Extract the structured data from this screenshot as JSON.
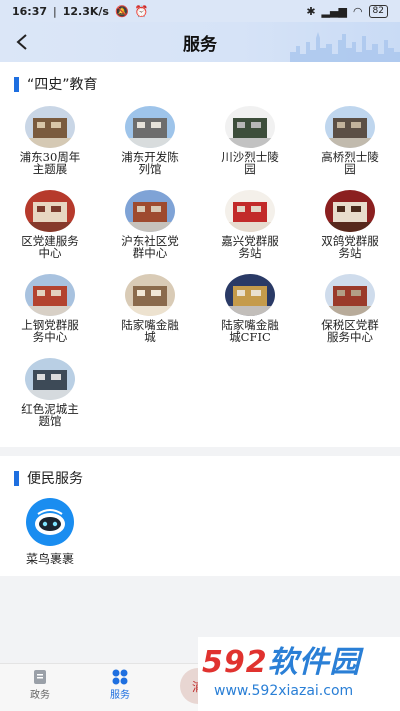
{
  "status": {
    "time": "16:37",
    "speed": "12.3K/s",
    "battery": "82"
  },
  "nav": {
    "title": "服务"
  },
  "education": {
    "title": "“四史”教育",
    "items": [
      {
        "label": "浦东30周年主题展",
        "icon": "exhibition-photo"
      },
      {
        "label": "浦东开发陈列馆",
        "icon": "museum-building-photo"
      },
      {
        "label": "川沙烈士陵园",
        "icon": "memorial-gate-photo"
      },
      {
        "label": "高桥烈士陵园",
        "icon": "memorial-statue-photo"
      },
      {
        "label": "区党建服务中心",
        "icon": "party-center-photo"
      },
      {
        "label": "沪东社区党群中心",
        "icon": "community-center-photo"
      },
      {
        "label": "嘉兴党群服务站",
        "icon": "service-station-photo"
      },
      {
        "label": "双鸽党群服务站",
        "icon": "service-hall-photo"
      },
      {
        "label": "上钢党群服务中心",
        "icon": "red-building-photo"
      },
      {
        "label": "陆家嘴金融城",
        "icon": "finance-hall-photo"
      },
      {
        "label": "陆家嘴金融城CFIC",
        "icon": "conference-room-photo"
      },
      {
        "label": "保税区党群服务中心",
        "icon": "bonded-zone-photo"
      },
      {
        "label": "红色泥城主题馆",
        "icon": "theme-hall-photo"
      }
    ]
  },
  "services": {
    "title": "便民服务",
    "items": [
      {
        "label": "菜鸟裹裹",
        "icon": "cainiao-robot-icon"
      }
    ]
  },
  "tabs": [
    {
      "label": "政务",
      "icon": "document-icon",
      "active": false
    },
    {
      "label": "服务",
      "icon": "grid-icon",
      "active": true
    }
  ],
  "watermark": {
    "brand": "592软件园",
    "url": "www.592xiazai.com"
  },
  "colors": {
    "accent": "#1e6fe0",
    "section_bar": "#1e6fe0",
    "watermark_blue": "#2a7fd6",
    "watermark_red": "#e0322f"
  }
}
